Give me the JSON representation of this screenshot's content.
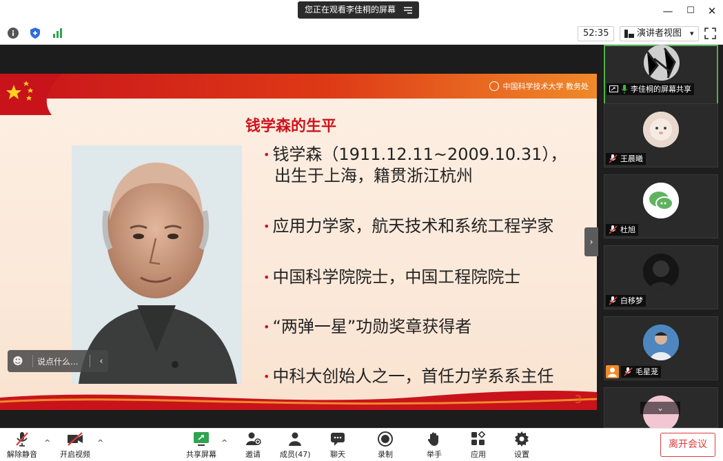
{
  "titlebar": {
    "sharing_text": "您正在观看李佳桐的屏幕",
    "controls": {
      "minimize": "—",
      "maximize": "☐",
      "close": "✕"
    }
  },
  "infobar": {
    "timer": "52:35",
    "view_label": "演讲者视图",
    "view_caret": "▾"
  },
  "slide": {
    "logo_text": "中国科学技术大学 教务处",
    "title": "钱学森的生平",
    "bullets": [
      {
        "line1": "钱学森（1911.12.11~2009.10.31），",
        "line2": "出生于上海，籍贯浙江杭州"
      },
      {
        "line1": "应用力学家，航天技术和系统工程学家",
        "line2": ""
      },
      {
        "line1": "中国科学院院士，中国工程院院士",
        "line2": ""
      },
      {
        "line1": "“两弹一星”功勋奖章获得者",
        "line2": ""
      },
      {
        "line1": "中科大创始人之一，首任力学系系主任",
        "line2": ""
      }
    ],
    "page_number": "3"
  },
  "chat": {
    "placeholder": "说点什么..."
  },
  "participants": [
    {
      "name": "李佳桐的屏幕共享",
      "active": true
    },
    {
      "name": "王晨曦",
      "muted": true
    },
    {
      "name": "杜旭",
      "muted": true
    },
    {
      "name": "白移梦",
      "muted": true
    },
    {
      "name": "毛星茏",
      "muted": true
    },
    {
      "name": "",
      "muted": false
    }
  ],
  "toolbar": {
    "unmute": "解除静音",
    "start_video": "开启视频",
    "share_screen": "共享屏幕",
    "invite": "邀请",
    "members": "成员(47)",
    "chat": "聊天",
    "record": "录制",
    "raise_hand": "举手",
    "apps": "应用",
    "settings": "设置",
    "leave": "离开会议"
  },
  "colors": {
    "accent_red": "#d0121b",
    "active_green": "#4db34d",
    "leave_red": "#e03a3a",
    "share_green": "#2ea44f"
  }
}
